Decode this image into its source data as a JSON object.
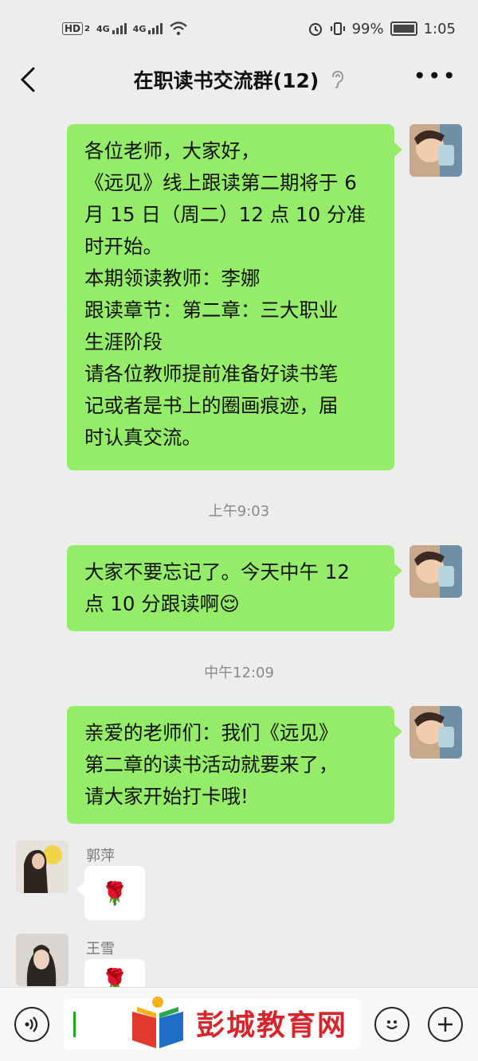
{
  "status_bar": {
    "network_badge": "HD",
    "network_badge_sub": "2",
    "sig1": "4G",
    "sig2": "4G",
    "battery": "99%",
    "time": "1:05"
  },
  "header": {
    "title": "在职读书交流群(12)",
    "back_icon": "chevron-left-icon",
    "more_icon": "more-dots-icon",
    "mute_icon": "ear-icon"
  },
  "messages": [
    {
      "sender": "self",
      "lines": [
        "各位老师，大家好，",
        "《远见》线上跟读第二期将于 6",
        "月 15 日（周二）12 点 10 分准",
        "时开始。",
        "本期领读教师：李娜",
        "跟读章节：第二章：三大职业",
        "生涯阶段",
        "请各位教师提前准备好读书笔",
        "记或者是书上的圈画痕迹，届",
        "时认真交流。"
      ]
    },
    {
      "time": "上午9:03"
    },
    {
      "sender": "self",
      "lines": [
        "大家不要忘记了。今天中午 12",
        "点 10 分跟读啊"
      ],
      "emoji": "😌"
    },
    {
      "time": "中午12:09"
    },
    {
      "sender": "self",
      "lines": [
        "亲爱的老师们：我们《远见》",
        "第二章的读书活动就要来了，",
        "请大家开始打卡哦!"
      ]
    },
    {
      "sender_name": "郭萍",
      "content": "🌹"
    },
    {
      "sender_name": "王雪",
      "content": "🌹"
    }
  ],
  "times": [
    "上午9:03",
    "中午12:09"
  ],
  "senders": [
    "郭萍",
    "王雪"
  ],
  "input_bar": {
    "voice_icon": "voice-icon",
    "emoji_icon": "smiley-icon",
    "plus_icon": "plus-icon"
  },
  "watermark": {
    "text": "彭城教育网"
  },
  "colors": {
    "bubble_green": "#95ec69",
    "background": "#ededed",
    "watermark_red": "#d8252c"
  }
}
